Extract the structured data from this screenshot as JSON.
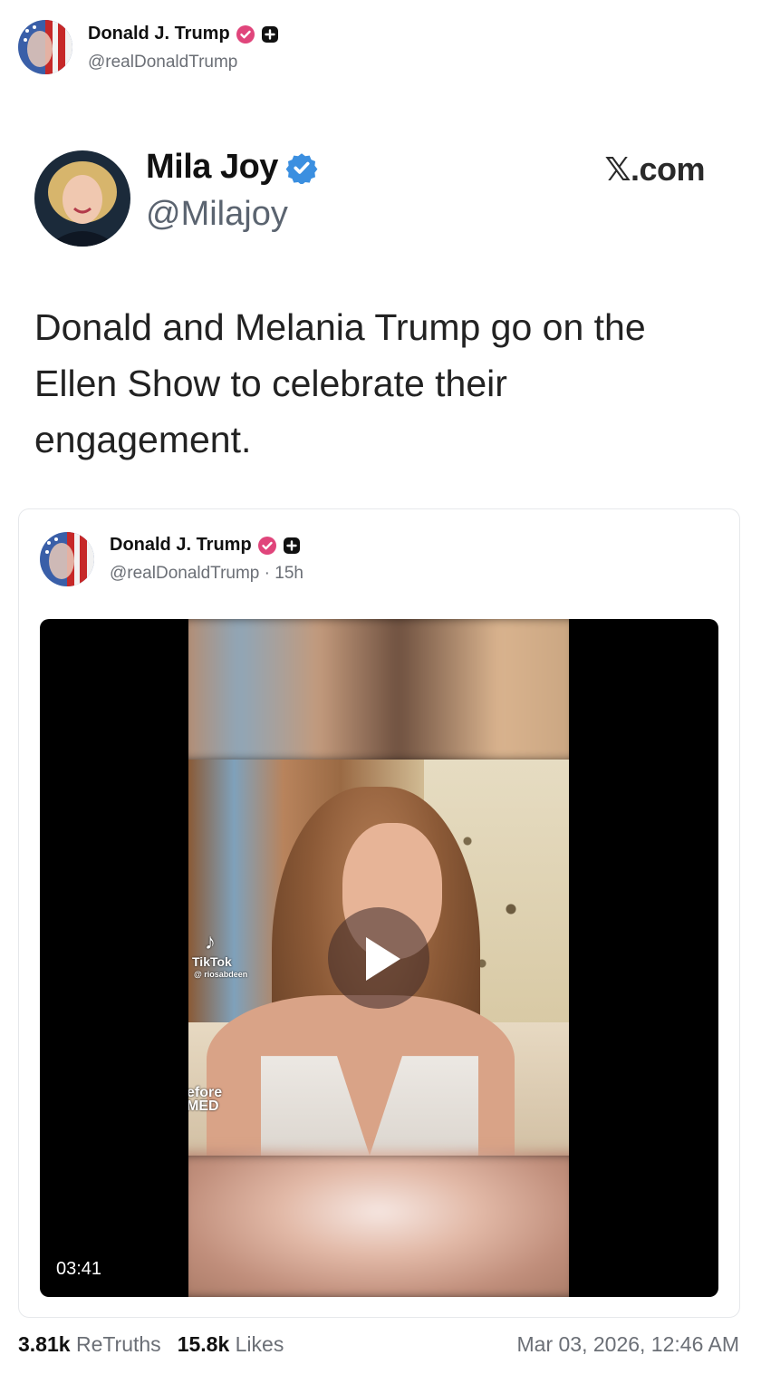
{
  "header": {
    "name": "Donald J. Trump",
    "handle": "@realDonaldTrump"
  },
  "quoted_tweet": {
    "name": "Mila Joy",
    "handle": "@Milajoy",
    "source": "𝕏.com",
    "text": "Donald and Melania Trump go on the Ellen Show to celebrate their engagement."
  },
  "card": {
    "name": "Donald J. Trump",
    "handle_time": "@realDonaldTrump · 15h",
    "video": {
      "duration": "03:41",
      "watermark_app": "TikTok",
      "watermark_user": "@ riosabdeen",
      "watermark_text": "efore\nMED"
    }
  },
  "stats": {
    "retruths_count": "3.81k",
    "retruths_label": "ReTruths",
    "likes_count": "15.8k",
    "likes_label": "Likes",
    "timestamp": "Mar 03, 2026, 12:46 AM"
  },
  "colors": {
    "verified_pink": "#e0457b",
    "verified_blue": "#3b8fe0",
    "text_gray": "#6b6f76"
  }
}
